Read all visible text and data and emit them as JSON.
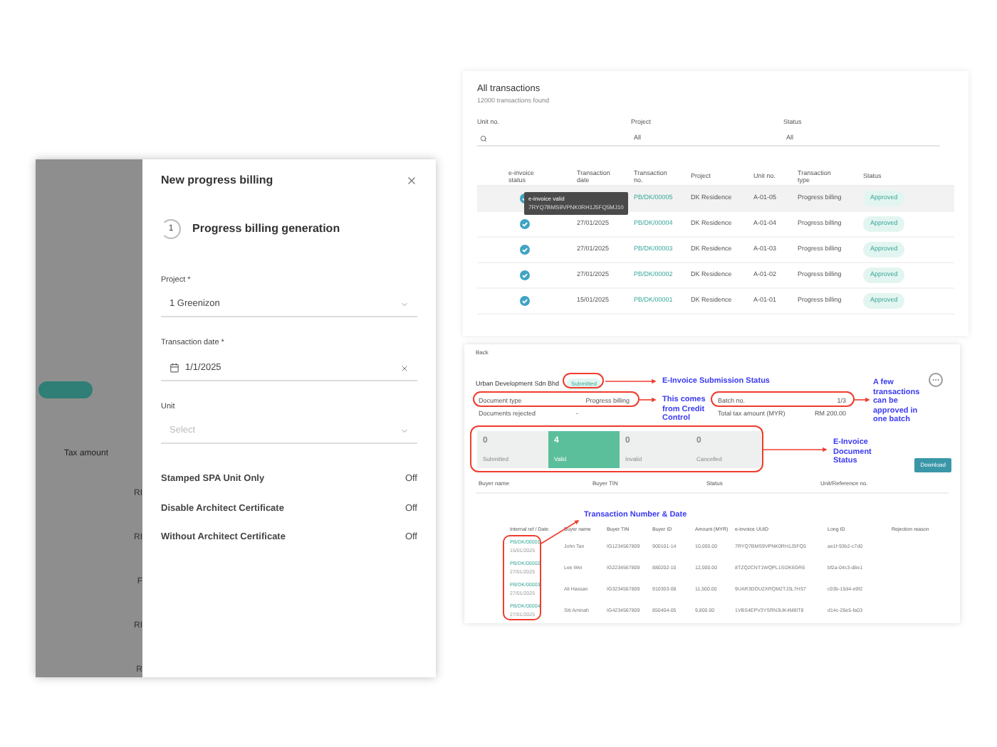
{
  "billing_screen": {
    "behind": {
      "tax_label": "Tax amount",
      "fragments": [
        "RI",
        "RI",
        "F",
        "RI",
        "R"
      ]
    },
    "drawer": {
      "title": "New progress billing",
      "step_number": "1",
      "step_title": "Progress billing generation",
      "fields": [
        {
          "kind": "select",
          "label": "Project *",
          "value": "1 Greenizon"
        },
        {
          "kind": "date",
          "label": "Transaction date *",
          "value": "1/1/2025"
        },
        {
          "kind": "select",
          "label": "Unit",
          "placeholder": "Select"
        }
      ],
      "toggles": [
        {
          "label": "Stamped SPA Unit Only",
          "value": "Off"
        },
        {
          "label": "Disable Architect Certificate",
          "value": "Off"
        },
        {
          "label": "Without Architect Certificate",
          "value": "Off"
        }
      ]
    }
  },
  "transactions_screen": {
    "title": "All transactions",
    "subtitle": "12000 transactions found",
    "filters": [
      {
        "kind": "search",
        "label": "Unit no."
      },
      {
        "kind": "select",
        "label": "Project",
        "value": "All"
      },
      {
        "kind": "select",
        "label": "Status",
        "value": "All"
      }
    ],
    "columns": [
      "e-invoice status",
      "Transaction date",
      "Transaction no.",
      "Project",
      "Unit no.",
      "Transaction type",
      "Status"
    ],
    "tooltip": {
      "title": "e-invoice valid",
      "text": "7RYQ7BMS9VPNK0RH1J5FQ5MJ10"
    },
    "rows": [
      {
        "selected": true,
        "number": "PB/DK/00005",
        "project": "DK Residence",
        "unit": "A-01-05",
        "type": "Progress billing",
        "status": "Approved"
      },
      {
        "selected": false,
        "date": "27/01/2025",
        "number": "PB/DK/00004",
        "project": "DK Residence",
        "unit": "A-01-04",
        "type": "Progress billing",
        "status": "Approved"
      },
      {
        "selected": false,
        "date": "27/01/2025",
        "number": "PB/DK/00003",
        "project": "DK Residence",
        "unit": "A-01-03",
        "type": "Progress billing",
        "status": "Approved"
      },
      {
        "selected": false,
        "date": "27/01/2025",
        "number": "PB/DK/00002",
        "project": "DK Residence",
        "unit": "A-01-02",
        "type": "Progress billing",
        "status": "Approved"
      },
      {
        "selected": false,
        "date": "15/01/2025",
        "number": "PB/DK/00001",
        "project": "DK Residence",
        "unit": "A-01-01",
        "type": "Progress billing",
        "status": "Approved"
      }
    ]
  },
  "batch_screen": {
    "back": "Back",
    "company": "Urban Development Sdn Bhd",
    "submission_status": "Submitted",
    "document_type": {
      "label": "Document type",
      "value": "Progress billing"
    },
    "batch": {
      "label": "Batch no.",
      "value": "1/3"
    },
    "rejected": {
      "label": "Documents rejected",
      "value": "-"
    },
    "total_tax": {
      "label": "Total tax amount (MYR)",
      "value": "RM 200.00"
    },
    "stats": [
      {
        "count": "0",
        "label": "Submitted",
        "selected": false
      },
      {
        "count": "4",
        "label": "Valid",
        "selected": true
      },
      {
        "count": "0",
        "label": "Invalid",
        "selected": false
      },
      {
        "count": "0",
        "label": "Cancelled",
        "selected": false
      }
    ],
    "action_button": "Download",
    "filters": [
      "Buyer name",
      "Buyer TIN",
      "Status",
      "Unit/Reference no."
    ],
    "columns": [
      "Internal ref / Date",
      "Buyer name",
      "Buyer TIN",
      "Buyer ID",
      "Amount (MYR)",
      "e-invoice UUID",
      "Long ID",
      "Rejection reason"
    ],
    "rows": [
      {
        "ref": "PB/DK/00001",
        "date": "15/01/2025",
        "buyer_name": "John Tan",
        "buyer_tin": "IG1234567809",
        "buyer_id": "900101-14",
        "amount": "10,000.00",
        "uuid": "7RYQ7BMS9VPNK0RH1J5FQ5",
        "long_id": "ae1f-93b2-c7d0"
      },
      {
        "ref": "PB/DK/00002",
        "date": "27/01/2025",
        "buyer_name": "Lee Wei",
        "buyer_tin": "IG2234567809",
        "buyer_id": "880202-10",
        "amount": "12,000.00",
        "uuid": "8TZQ2CNT1WQPL1SI2K6GR6",
        "long_id": "bf2a-04c3-d8e1"
      },
      {
        "ref": "PB/DK/00003",
        "date": "27/01/2025",
        "buyer_name": "Ali Hassan",
        "buyer_tin": "IG3234567809",
        "buyer_id": "910303-08",
        "amount": "11,500.00",
        "uuid": "9UAR3DOU2XRQM2TJ3L7HS7",
        "long_id": "c03b-15d4-e9f2"
      },
      {
        "ref": "PB/DK/00004",
        "date": "27/01/2025",
        "buyer_name": "Siti Aminah",
        "buyer_tin": "IG4234567809",
        "buyer_id": "850404-05",
        "amount": "9,800.00",
        "uuid": "1VBS4EPV3YSRN3UK4M8IT8",
        "long_id": "d14c-26e5-fa03"
      }
    ],
    "annotations": [
      "E-Invoice Submission Status",
      "This comes from Credit Control",
      "A few transactions can be approved in one batch",
      "E-Invoice Document Status",
      "Transaction Number & Date"
    ]
  }
}
